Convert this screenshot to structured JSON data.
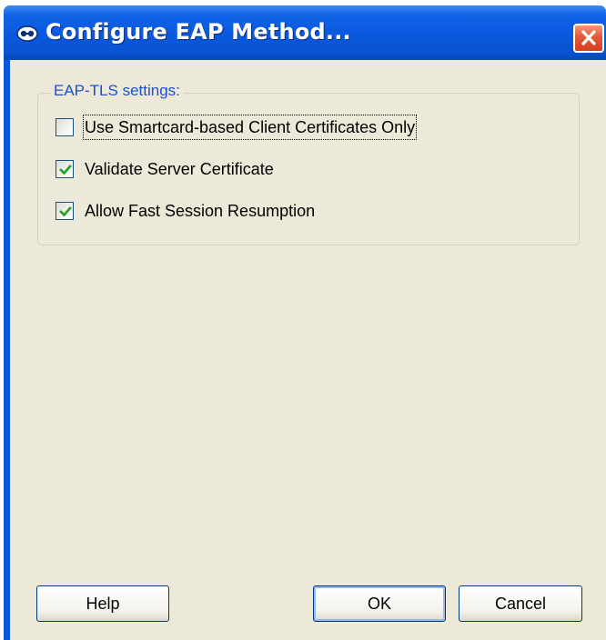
{
  "window": {
    "title": "Configure EAP Method..."
  },
  "group": {
    "legend": "EAP-TLS settings:"
  },
  "options": [
    {
      "label": "Use Smartcard-based Client Certificates Only",
      "checked": false
    },
    {
      "label": "Validate Server Certificate",
      "checked": true
    },
    {
      "label": "Allow Fast Session Resumption",
      "checked": true
    }
  ],
  "buttons": {
    "help": "Help",
    "ok": "OK",
    "cancel": "Cancel"
  },
  "icons": {
    "title": "network-adapter-icon",
    "close": "close-icon",
    "check": "checkmark-icon"
  },
  "colors": {
    "titlebar": "#0a56d8",
    "client": "#ece9d8",
    "legend_text": "#1a4fd0",
    "close": "#d4401f",
    "check": "#21a121"
  }
}
